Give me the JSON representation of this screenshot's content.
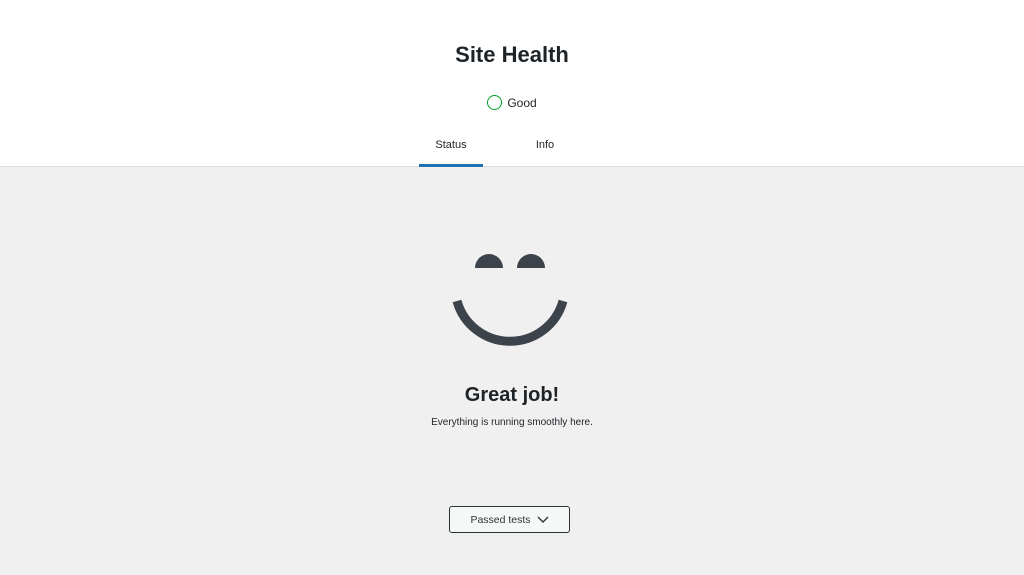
{
  "header": {
    "title": "Site Health",
    "status_label": "Good",
    "status_color": "#00a32a"
  },
  "tabs": [
    {
      "label": "Status",
      "active": true
    },
    {
      "label": "Info",
      "active": false
    }
  ],
  "main": {
    "heading": "Great job!",
    "subtext": "Everything is running smoothly here.",
    "passed_button_label": "Passed tests",
    "passed_button_icon": "chevron-down-icon"
  },
  "colors": {
    "accent": "#2271b1",
    "good": "#00a32a",
    "face": "#3c434a"
  }
}
